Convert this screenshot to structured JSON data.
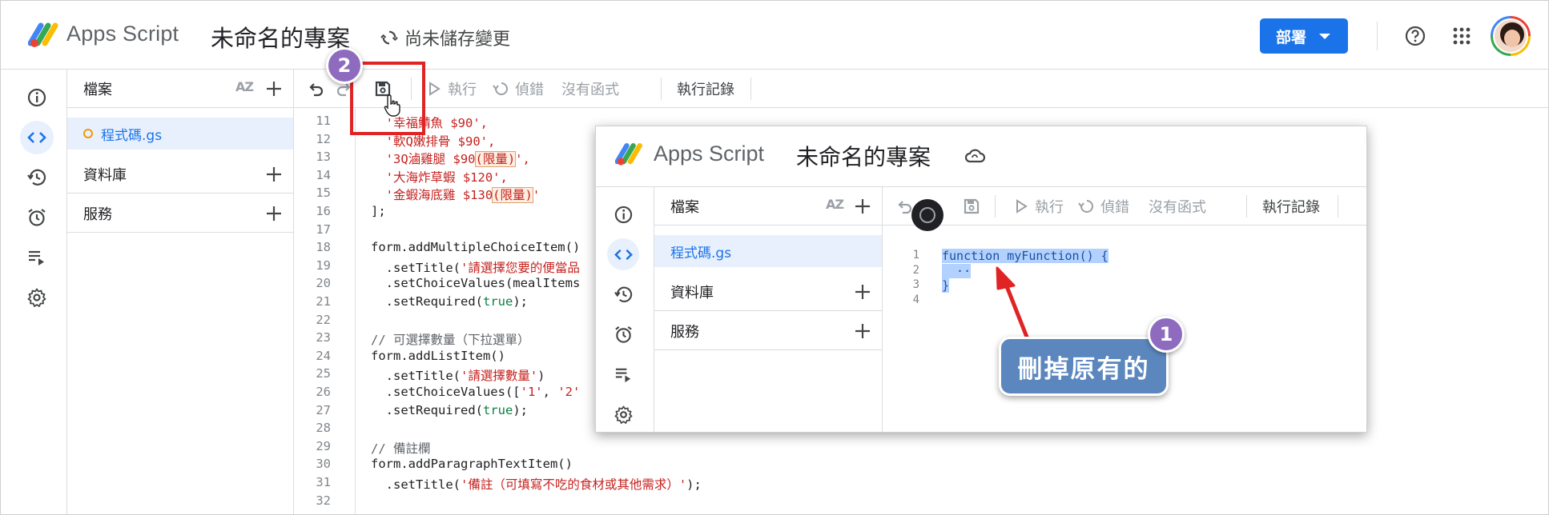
{
  "header": {
    "app_name": "Apps Script",
    "project_title": "未命名的專案",
    "save_status": "尚未儲存變更",
    "deploy_label": "部署"
  },
  "files_panel": {
    "files_label": "檔案",
    "sort_label": "AZ",
    "file_name": "程式碼.gs",
    "libraries_label": "資料庫",
    "services_label": "服務"
  },
  "toolbar": {
    "run_label": "執行",
    "debug_label": "偵錯",
    "function_label": "沒有函式",
    "log_label": "執行記錄"
  },
  "editor": {
    "lines": [
      {
        "n": "11",
        "parts": [
          {
            "t": "  '幸福鯖魚 $90',",
            "c": "s"
          }
        ]
      },
      {
        "n": "12",
        "parts": [
          {
            "t": "  '軟Q嫩排骨 $90',",
            "c": "s"
          }
        ]
      },
      {
        "n": "13",
        "parts": [
          {
            "t": "  '3Q滷雞腿 $90",
            "c": "s"
          },
          {
            "t": "(限量)",
            "c": "s hl"
          },
          {
            "t": "',",
            "c": "s"
          }
        ]
      },
      {
        "n": "14",
        "parts": [
          {
            "t": "  '大海炸草蝦 $120',",
            "c": "s"
          }
        ]
      },
      {
        "n": "15",
        "parts": [
          {
            "t": "  '金蝦海底雞 $130",
            "c": "s"
          },
          {
            "t": "(限量)",
            "c": "s hl"
          },
          {
            "t": "'",
            "c": "s"
          }
        ]
      },
      {
        "n": "16",
        "parts": [
          {
            "t": "];",
            "c": ""
          }
        ]
      },
      {
        "n": "17",
        "parts": [
          {
            "t": "",
            "c": ""
          }
        ]
      },
      {
        "n": "18",
        "parts": [
          {
            "t": "form.addMultipleChoiceItem()",
            "c": ""
          }
        ]
      },
      {
        "n": "19",
        "parts": [
          {
            "t": "  .setTitle(",
            "c": ""
          },
          {
            "t": "'請選擇您要的便當品",
            "c": "s"
          }
        ]
      },
      {
        "n": "20",
        "parts": [
          {
            "t": "  .setChoiceValues(mealItems",
            "c": ""
          }
        ]
      },
      {
        "n": "21",
        "parts": [
          {
            "t": "  .setRequired(",
            "c": ""
          },
          {
            "t": "true",
            "c": "b"
          },
          {
            "t": ");",
            "c": ""
          }
        ]
      },
      {
        "n": "22",
        "parts": [
          {
            "t": "",
            "c": ""
          }
        ]
      },
      {
        "n": "23",
        "parts": [
          {
            "t": "// 可選擇數量（下拉選單）",
            "c": "c"
          }
        ]
      },
      {
        "n": "24",
        "parts": [
          {
            "t": "form.addListItem()",
            "c": ""
          }
        ]
      },
      {
        "n": "25",
        "parts": [
          {
            "t": "  .setTitle(",
            "c": ""
          },
          {
            "t": "'請選擇數量'",
            "c": "s"
          },
          {
            "t": ")",
            "c": ""
          }
        ]
      },
      {
        "n": "26",
        "parts": [
          {
            "t": "  .setChoiceValues([",
            "c": ""
          },
          {
            "t": "'1'",
            "c": "s"
          },
          {
            "t": ", ",
            "c": ""
          },
          {
            "t": "'2'",
            "c": "s"
          }
        ]
      },
      {
        "n": "27",
        "parts": [
          {
            "t": "  .setRequired(",
            "c": ""
          },
          {
            "t": "true",
            "c": "b"
          },
          {
            "t": ");",
            "c": ""
          }
        ]
      },
      {
        "n": "28",
        "parts": [
          {
            "t": "",
            "c": ""
          }
        ]
      },
      {
        "n": "29",
        "parts": [
          {
            "t": "// 備註欄",
            "c": "c"
          }
        ]
      },
      {
        "n": "30",
        "parts": [
          {
            "t": "form.addParagraphTextItem()",
            "c": ""
          }
        ]
      },
      {
        "n": "31",
        "parts": [
          {
            "t": "  .setTitle(",
            "c": ""
          },
          {
            "t": "'備註（可填寫不吃的食材或其他需求）'",
            "c": "s"
          },
          {
            "t": ");",
            "c": ""
          }
        ]
      },
      {
        "n": "32",
        "parts": [
          {
            "t": "",
            "c": ""
          }
        ]
      }
    ]
  },
  "overlay": {
    "app_name": "Apps Script",
    "project_title": "未命名的專案",
    "files_label": "檔案",
    "sort_label": "AZ",
    "file_name": "程式碼.gs",
    "libraries_label": "資料庫",
    "services_label": "服務",
    "run_label": "執行",
    "debug_label": "偵錯",
    "function_label": "沒有函式",
    "log_label": "執行記錄",
    "lines": [
      {
        "n": "1",
        "text": "function myFunction() {"
      },
      {
        "n": "2",
        "text": "  ··"
      },
      {
        "n": "3",
        "text": "}"
      },
      {
        "n": "4",
        "text": ""
      }
    ]
  },
  "annotations": {
    "callout_text": "刪掉原有的",
    "step1": "1",
    "step2": "2",
    "colors": {
      "callout": "#5b87be",
      "badge": "#8e6bbf",
      "arrow": "#e02424"
    }
  }
}
